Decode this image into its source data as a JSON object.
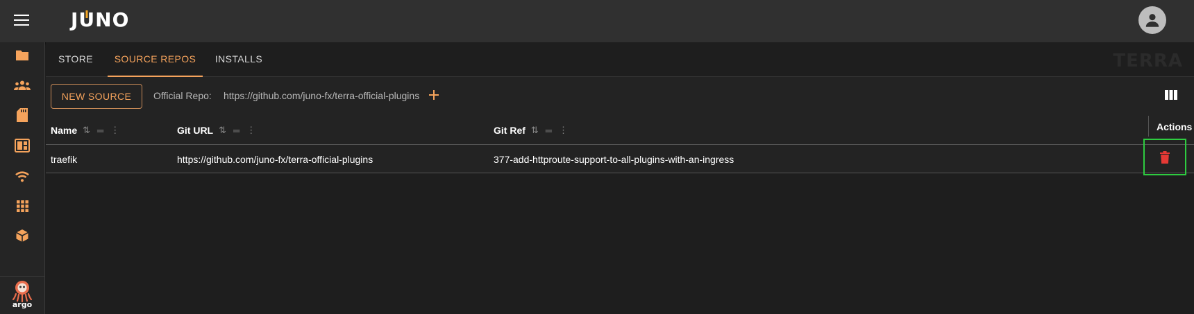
{
  "header": {
    "logo_text_j": "J",
    "logo_text_u": "U",
    "logo_text_no": "NO",
    "menu_icon": "hamburger-icon",
    "avatar_icon": "account-circle-icon"
  },
  "sidebar": {
    "items": [
      {
        "icon": "folder-icon"
      },
      {
        "icon": "groups-icon"
      },
      {
        "icon": "sd-card-icon"
      },
      {
        "icon": "dashboard-icon"
      },
      {
        "icon": "wifi-icon"
      },
      {
        "icon": "apps-grid-icon"
      },
      {
        "icon": "package-icon"
      }
    ],
    "bottom_icon": "argo-octopus-icon",
    "bottom_label": "argo"
  },
  "tabs": [
    {
      "label": "STORE",
      "active": false
    },
    {
      "label": "SOURCE REPOS",
      "active": true
    },
    {
      "label": "INSTALLS",
      "active": false
    }
  ],
  "watermark": "TERRA",
  "toolbar": {
    "new_source_label": "NEW SOURCE",
    "official_repo_label": "Official Repo:",
    "official_repo_url": "https://github.com/juno-fx/terra-official-plugins",
    "add_icon": "plus-icon",
    "columns_icon": "view-column-icon"
  },
  "table": {
    "columns": [
      {
        "label": "Name"
      },
      {
        "label": "Git URL"
      },
      {
        "label": "Git Ref"
      },
      {
        "label": "Actions"
      }
    ],
    "rows": [
      {
        "name": "traefik",
        "git_url": "https://github.com/juno-fx/terra-official-plugins",
        "git_ref": "377-add-httproute-support-to-all-plugins-with-an-ingress",
        "action_icon": "delete-icon"
      }
    ]
  },
  "colors": {
    "accent": "#f5a35c",
    "delete": "#e53935",
    "highlight": "#2ecc40",
    "appbar": "#303030",
    "background": "#1e1e1e"
  }
}
